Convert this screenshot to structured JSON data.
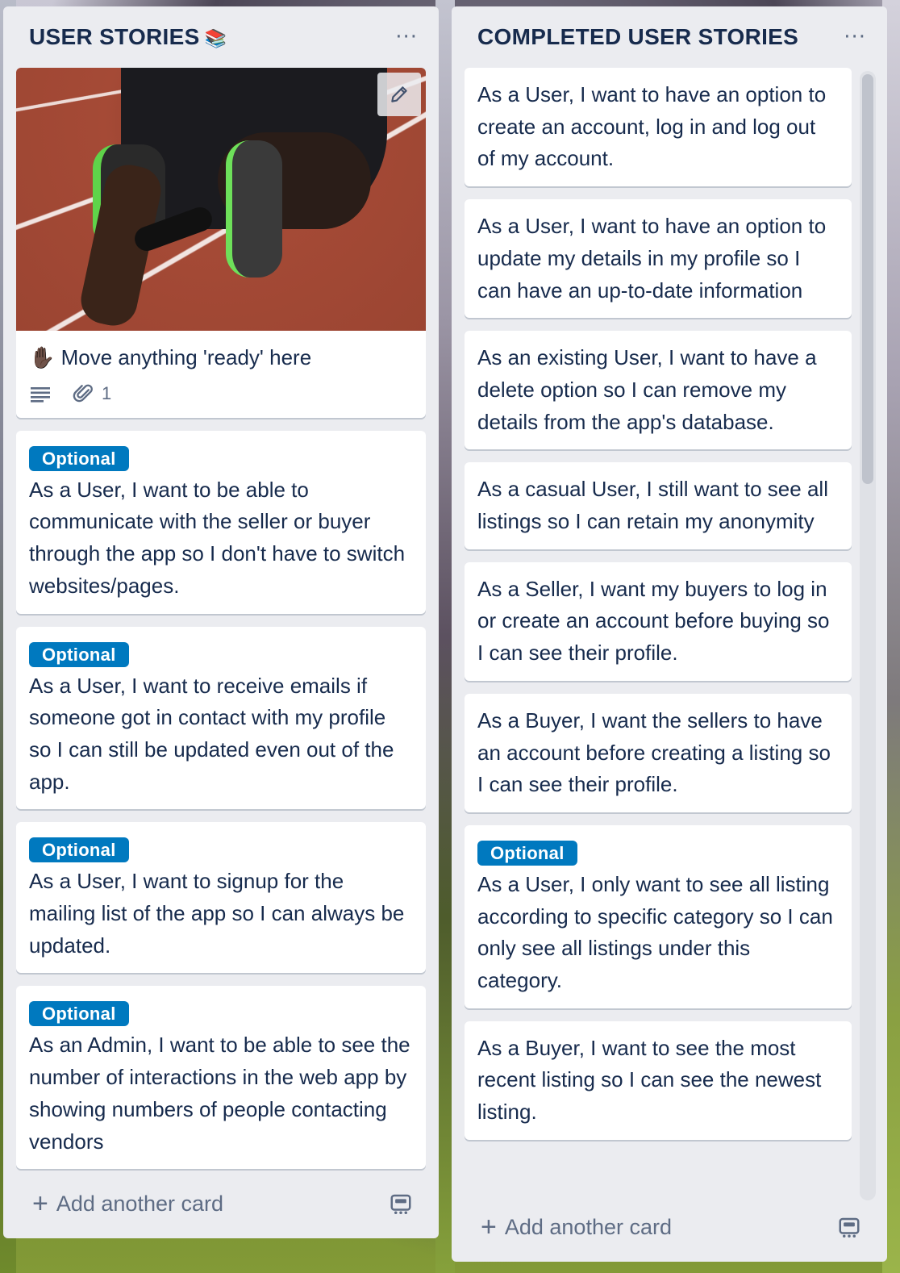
{
  "lists": {
    "left": {
      "title": "USER STORIES",
      "title_emoji": "📚",
      "menu_icon": "···",
      "cover_card": {
        "title": "Move anything 'ready' here",
        "emoji": "✋🏿",
        "attachment_count": "1"
      },
      "cards": [
        {
          "label": "Optional",
          "text": "As a User, I want to be able to communicate with the seller or buyer through the app so I don't have to switch websites/pages."
        },
        {
          "label": "Optional",
          "text": "As a User, I want to receive emails if someone got in contact with my profile so I can still be updated even out of the app."
        },
        {
          "label": "Optional",
          "text": "As a User, I want to signup for the mailing list of the app so I can always be updated."
        },
        {
          "label": "Optional",
          "text": "As an Admin, I want to be able to see the number of interactions in the web app by showing numbers of people contacting vendors"
        }
      ],
      "add_card_label": "Add another card"
    },
    "right": {
      "title": "COMPLETED USER STORIES",
      "menu_icon": "···",
      "cards": [
        {
          "text": "As a User, I want to have an option to create an account, log in and log out of my account."
        },
        {
          "text": "As a User, I want to have an option to update my details in my profile so I can have an up-to-date information"
        },
        {
          "text": "As an existing User, I want to have a delete option so I can remove my details from the app's database."
        },
        {
          "text": "As a casual User, I still want to see all listings so I can retain my anonymity"
        },
        {
          "text": "As a Seller, I want my buyers to log in or create an account before buying so I can see their profile."
        },
        {
          "text": "As a Buyer, I want the sellers to have an account before creating a listing so I can see their profile."
        },
        {
          "label": "Optional",
          "text": "As a User, I only want to see all listing according to specific category so I can only see all listings under this category."
        },
        {
          "text": "As a Buyer, I want to see the most recent listing so I can see the newest listing."
        }
      ],
      "add_card_label": "Add another card"
    }
  },
  "colors": {
    "label_blue": "#0079bf",
    "list_bg": "#ebecf0",
    "text": "#172b4d",
    "muted": "#5e6c84"
  }
}
